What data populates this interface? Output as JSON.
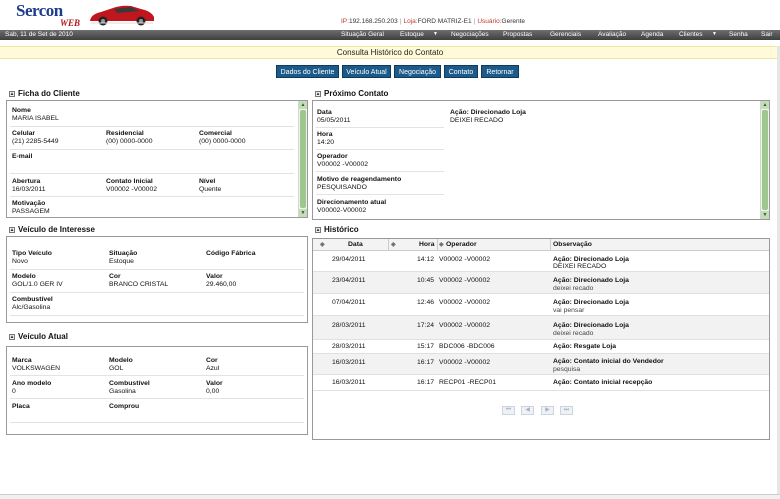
{
  "brand": {
    "name": "Sercon",
    "sub": "WEB"
  },
  "meta": {
    "ip_label": "IP:",
    "ip_value": "192.168.250.203",
    "loja_label": "Loja:",
    "loja_value": "FORD MATRIZ-E1",
    "usuario_label": "Usuário:",
    "usuario_value": "Gerente"
  },
  "nav": {
    "date": "Sab, 11 de Set de 2010",
    "items": [
      "Situação Geral",
      "Estoque",
      "Negociações",
      "Propostas",
      "Gerenciais",
      "Avaliação",
      "Agenda",
      "Clientes",
      "Senha",
      "Sair"
    ]
  },
  "subtitle": "Consulta Histórico do Contato",
  "buttons": [
    "Dados do Cliente",
    "Veículo Atual",
    "Negociação",
    "Contato",
    "Retornar"
  ],
  "ficha": {
    "title": "Ficha do Cliente",
    "nome_label": "Nome",
    "nome": "MARIA ISABEL",
    "celular_label": "Celular",
    "celular": "(21) 2285-5449",
    "residencial_label": "Residencial",
    "residencial": "(00) 0000-0000",
    "comercial_label": "Comercial",
    "comercial": "(00) 0000-0000",
    "email_label": "E-mail",
    "email": "",
    "abertura_label": "Abertura",
    "abertura": "16/03/2011",
    "contato_label": "Contato Inicial",
    "contato": "V00002 -V00002",
    "nivel_label": "Nível",
    "nivel": "Quente",
    "motivacao_label": "Motivação",
    "motivacao": "PASSAGEM"
  },
  "interesse": {
    "title": "Veículo de Interesse",
    "tipo_label": "Tipo Veículo",
    "tipo": "Novo",
    "situacao_label": "Situação",
    "situacao": "Estoque",
    "codigo_label": "Código Fábrica",
    "codigo": "",
    "modelo_label": "Modelo",
    "modelo": "GOL/1.0 GER IV",
    "cor_label": "Cor",
    "cor": "BRANCO CRISTAL",
    "valor_label": "Valor",
    "valor": "29.460,00",
    "comb_label": "Combustível",
    "comb": "Alc/Gasolina"
  },
  "atual": {
    "title": "Veículo Atual",
    "marca_label": "Marca",
    "marca": "VOLKSWAGEN",
    "modelo_label": "Modelo",
    "modelo": "GOL",
    "cor_label": "Cor",
    "cor": "Azul",
    "ano_label": "Ano modelo",
    "ano": "0",
    "comb_label": "Combustível",
    "comb": "Gasolina",
    "valor_label": "Valor",
    "valor": "0,00",
    "placa_label": "Placa",
    "placa": "",
    "comprou_label": "Comprou",
    "comprou": ""
  },
  "proximo": {
    "title": "Próximo Contato",
    "data_label": "Data",
    "data": "05/05/2011",
    "acao_label": "Ação: Direcionado Loja",
    "acao": "DEIXEI RECADO",
    "hora_label": "Hora",
    "hora": "14:20",
    "operador_label": "Operador",
    "operador": "V00002 -V00002",
    "motivo_label": "Motivo de reagendamento",
    "motivo": "PESQUISANDO",
    "direcionamento_label": "Direcionamento atual",
    "direcionamento": "V00002-V00002"
  },
  "historico": {
    "title": "Histórico",
    "headers": {
      "data": "Data",
      "hora": "Hora",
      "operador": "Operador",
      "observacao": "Observação"
    },
    "rows": [
      {
        "data": "29/04/2011",
        "hora": "14:12",
        "operador": "V00002 -V00002",
        "acao": "Ação: Direcionado Loja",
        "obs": "DEIXEI RECADO"
      },
      {
        "data": "23/04/2011",
        "hora": "10:45",
        "operador": "V00002 -V00002",
        "acao": "Ação: Direcionado Loja",
        "obs": "deixei recado"
      },
      {
        "data": "07/04/2011",
        "hora": "12:46",
        "operador": "V00002 -V00002",
        "acao": "Ação: Direcionado Loja",
        "obs": "vai pensar"
      },
      {
        "data": "28/03/2011",
        "hora": "17:24",
        "operador": "V00002 -V00002",
        "acao": "Ação: Direcionado Loja",
        "obs": "deixei recado"
      },
      {
        "data": "28/03/2011",
        "hora": "15:17",
        "operador": "BDC006 -BDC006",
        "acao": "Ação: Resgate Loja",
        "obs": ""
      },
      {
        "data": "16/03/2011",
        "hora": "16:17",
        "operador": "V00002 -V00002",
        "acao": "Ação: Contato inicial do Vendedor",
        "obs": "pesquisa"
      },
      {
        "data": "16/03/2011",
        "hora": "16:17",
        "operador": "RECP01 -RECP01",
        "acao": "Ação: Contato inicial recepção",
        "obs": ""
      }
    ]
  }
}
